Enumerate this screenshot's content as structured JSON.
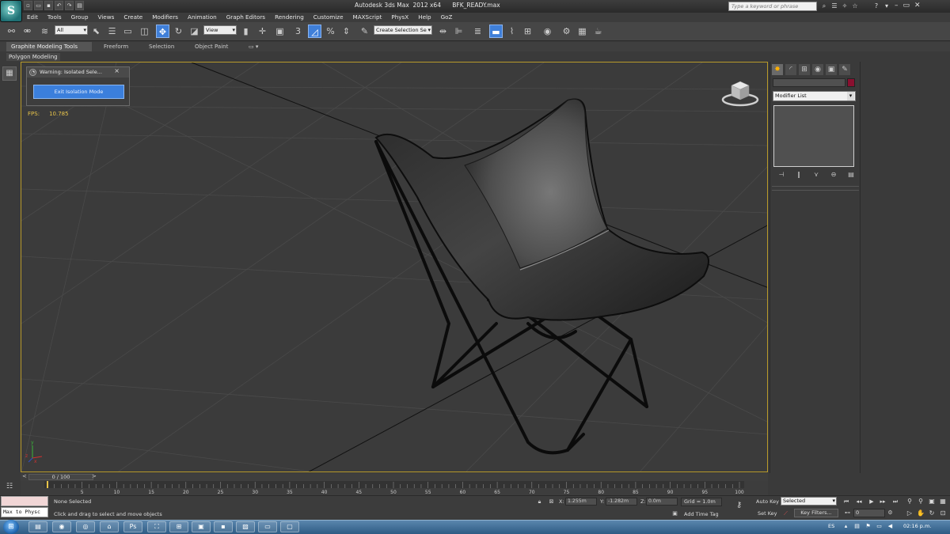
{
  "window": {
    "title": "Autodesk 3ds Max  2012 x64      BFK_READY.max",
    "search_placeholder": "Type a keyword or phrase",
    "logo_letter": "S"
  },
  "menu": [
    "Edit",
    "Tools",
    "Group",
    "Views",
    "Create",
    "Modifiers",
    "Animation",
    "Graph Editors",
    "Rendering",
    "Customize",
    "MAXScript",
    "PhysX",
    "Help",
    "GoZ"
  ],
  "toolbar": {
    "filter_value": "All",
    "coord_value": "View",
    "selection_set_value": "Create Selection Se"
  },
  "ribbon": {
    "tabs": [
      "Graphite Modeling Tools",
      "Freeform",
      "Selection",
      "Object Paint"
    ],
    "panel_label": "Polygon Modeling"
  },
  "viewport": {
    "fps_label": "FPS:",
    "fps_value": "10.785"
  },
  "isolation_dialog": {
    "title": "Warning: Isolated Sele...",
    "exit_button": "Exit Isolation Mode"
  },
  "command_panel": {
    "modifier_list": "Modifier List"
  },
  "timeline": {
    "slider_label": "0 / 100",
    "ticks": [
      "5",
      "10",
      "15",
      "20",
      "25",
      "30",
      "35",
      "40",
      "45",
      "50",
      "55",
      "60",
      "65",
      "70",
      "75",
      "80",
      "85",
      "90",
      "95",
      "100"
    ]
  },
  "status": {
    "maxscript_text": "Max to Physc",
    "selection_status": "None Selected",
    "prompt": "Click and drag to select and move objects",
    "x_label": "X:",
    "x_value": "1.255m",
    "y_label": "Y:",
    "y_value": "-1.282m",
    "z_label": "Z:",
    "z_value": "0.0m",
    "grid": "Grid = 1.0m",
    "add_time_tag": "Add Time Tag",
    "auto_key": "Auto Key",
    "set_key": "Set Key",
    "selected_dropdown": "Selected",
    "key_filters": "Key Filters...",
    "frame_value": "0"
  },
  "taskbar": {
    "language": "ES",
    "clock": "02:16 p.m."
  },
  "colors": {
    "accent_blue": "#3b7fdc",
    "viewport_border": "#b89a2b",
    "fps_color": "#e8c44a",
    "object_color_swatch": "#8a1030"
  }
}
